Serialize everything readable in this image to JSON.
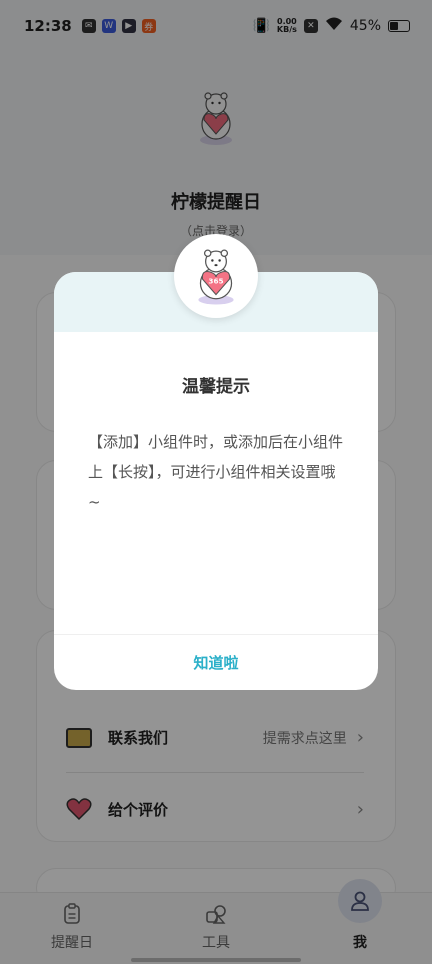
{
  "status_bar": {
    "time": "12:38",
    "net_speed_value": "0.00",
    "net_speed_unit": "KB/s",
    "battery": "45%",
    "battery_level": 0.45,
    "notification_icons": [
      "mail-icon",
      "app-icon-blue",
      "play-icon",
      "app-icon-orange"
    ]
  },
  "profile": {
    "app_name": "柠檬提醒日",
    "login_hint": "（点击登录）",
    "mascot_badge": "365"
  },
  "menu": [
    {
      "label": "联系我们",
      "hint": "提需求点这里",
      "icon": "message-icon"
    },
    {
      "label": "给个评价",
      "hint": "",
      "icon": "heart-icon"
    }
  ],
  "bottom_nav": [
    {
      "label": "提醒日",
      "icon": "calendar-icon"
    },
    {
      "label": "工具",
      "icon": "tools-icon"
    },
    {
      "label": "我",
      "icon": "user-icon",
      "active": true
    }
  ],
  "dialog": {
    "title": "温馨提示",
    "message": "【添加】小组件时，或添加后在小组件上【长按】，可进行小组件相关设置哦~",
    "confirm_label": "知道啦",
    "mascot_badge": "365"
  },
  "colors": {
    "accent": "#2bb0c9",
    "dialog_header": "#e8f4f6",
    "overlay": "rgba(0,0,0,0.42)"
  }
}
